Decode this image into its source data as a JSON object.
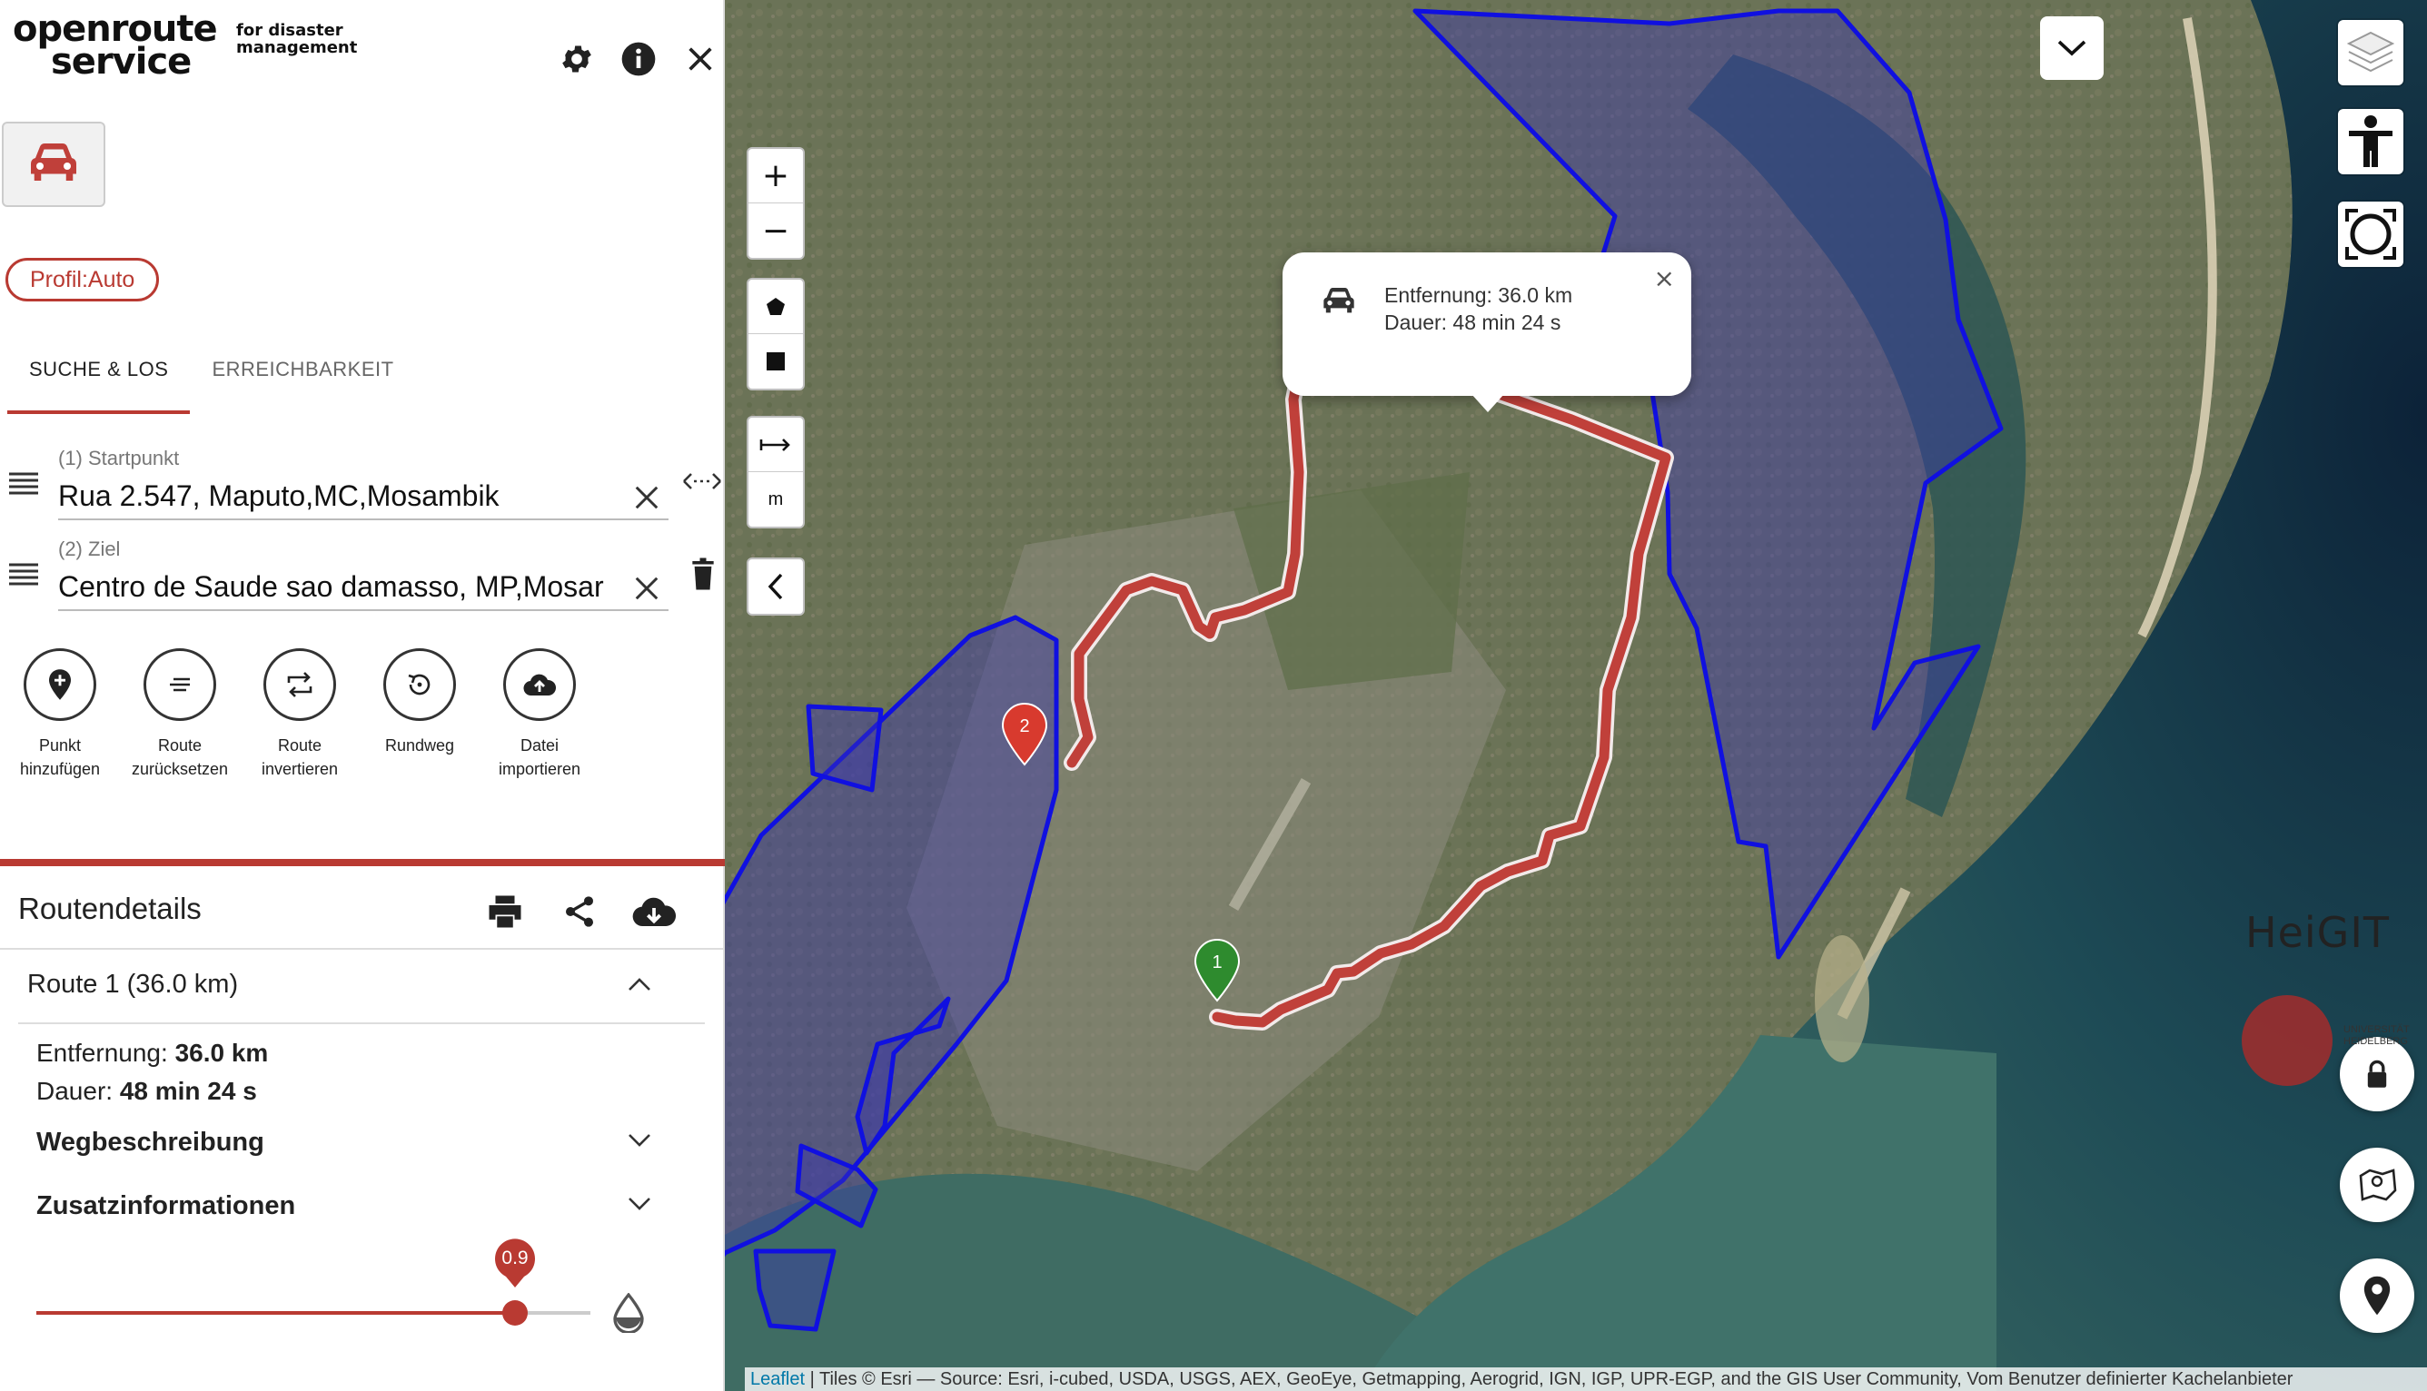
{
  "app": {
    "logo_line1": "openroute",
    "logo_line2": "service",
    "logo_sub": "for disaster management"
  },
  "profile": {
    "chip_label": "Profil:Auto",
    "icon": "car-icon"
  },
  "tabs": [
    {
      "label": "SUCHE & LOS",
      "active": true
    },
    {
      "label": "ERREICHBARKEIT",
      "active": false
    }
  ],
  "places": [
    {
      "label": "(1) Startpunkt",
      "value": "Rua 2.547, Maputo,MC,Mosambik"
    },
    {
      "label": "(2) Ziel",
      "value": "Centro de Saude sao damasso, MP,Mosar"
    }
  ],
  "actions": [
    {
      "label": "Punkt hinzufügen",
      "icon": "add-pin-icon"
    },
    {
      "label": "Route zurücksetzen",
      "icon": "reset-icon"
    },
    {
      "label": "Route invertieren",
      "icon": "swap-icon"
    },
    {
      "label": "Rundweg",
      "icon": "roundtrip-icon"
    },
    {
      "label": "Datei importieren",
      "icon": "cloud-upload-icon"
    }
  ],
  "details": {
    "title": "Routendetails",
    "route_title": "Route 1 (36.0 km)",
    "distance_label": "Entfernung:",
    "distance_value": "36.0 km",
    "duration_label": "Dauer:",
    "duration_value": "48 min 24 s",
    "directions_label": "Wegbeschreibung",
    "extra_info_label": "Zusatzinformationen",
    "opacity_value": "0.9",
    "opacity_fraction": 0.9
  },
  "map": {
    "popup_line1": "Entfernung: 36.0 km",
    "popup_line2": "Dauer: 48 min 24 s",
    "zoom_in": "+",
    "zoom_out": "−",
    "scale_unit": "m",
    "marker_start": "1",
    "marker_end": "2",
    "heigit": "HeiGIT",
    "uni_text": "UNIVERSITÄT HEIDELBERG",
    "attribution_leaflet": "Leaflet",
    "attribution_rest": " | Tiles © Esri — Source: Esri, i-cubed, USDA, USGS, AEX, GeoEye, Getmapping, Aerogrid, IGN, IGP, UPR-EGP, and the GIS User Community, Vom Benutzer definierter Kachelanbieter"
  },
  "colors": {
    "accent": "#b93a32",
    "route": "#c0403a",
    "polygon_stroke": "#1010e0",
    "polygon_fill": "#3a35b0"
  }
}
